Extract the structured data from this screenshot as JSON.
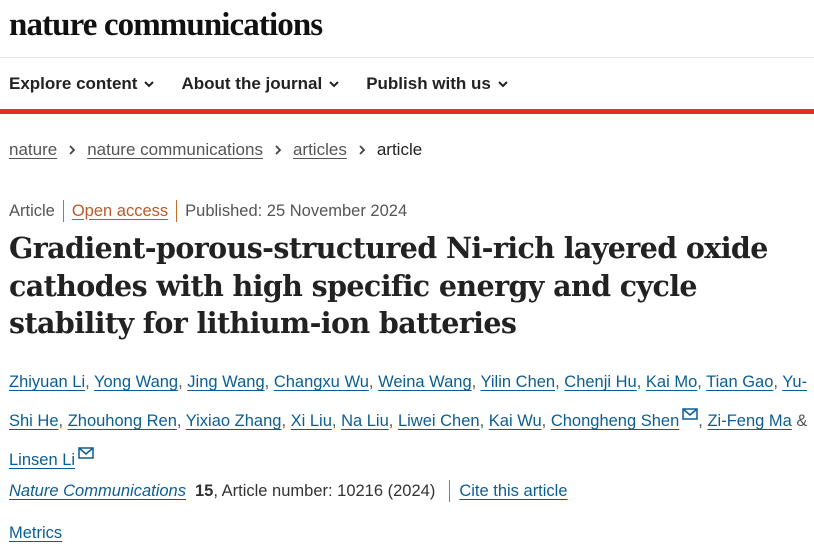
{
  "site": {
    "logo": "nature communications"
  },
  "nav": {
    "items": [
      {
        "label": "Explore content"
      },
      {
        "label": "About the journal"
      },
      {
        "label": "Publish with us"
      }
    ]
  },
  "breadcrumb": {
    "items": [
      "nature",
      "nature communications",
      "articles"
    ],
    "current": "article"
  },
  "meta": {
    "type": "Article",
    "access": "Open access",
    "published": "Published: 25 November 2024"
  },
  "article": {
    "title": "Gradient-porous-structured Ni-rich layered oxide cathodes with high specific energy and cycle stability for lithium-ion batteries"
  },
  "authors": {
    "list": [
      "Zhiyuan Li",
      "Yong Wang",
      "Jing Wang",
      "Changxu Wu",
      "Weina Wang",
      "Yilin Chen",
      "Chenji Hu",
      "Kai Mo",
      "Tian Gao",
      "Yu-Shi He",
      "Zhouhong Ren",
      "Yixiao Zhang",
      "Xi Liu",
      "Na Liu",
      "Liwei Chen",
      "Kai Wu",
      "Chongheng Shen",
      "Zi-Feng Ma",
      "Linsen Li"
    ],
    "separator": ", ",
    "conjunction": "& "
  },
  "citation": {
    "journal": "Nature Communications",
    "volume": "15",
    "details": ", Article number: 10216 (2024)",
    "cite_label": "Cite this article"
  },
  "metrics_label": "Metrics",
  "colors": {
    "accent_red": "#e0301e",
    "link_blue": "#0b5e93",
    "open_access": "#b85a2b"
  },
  "icons": {
    "nav_chevron": "chevron-down-icon",
    "breadcrumb_sep": "chevron-right-icon",
    "email": "mail-icon"
  }
}
